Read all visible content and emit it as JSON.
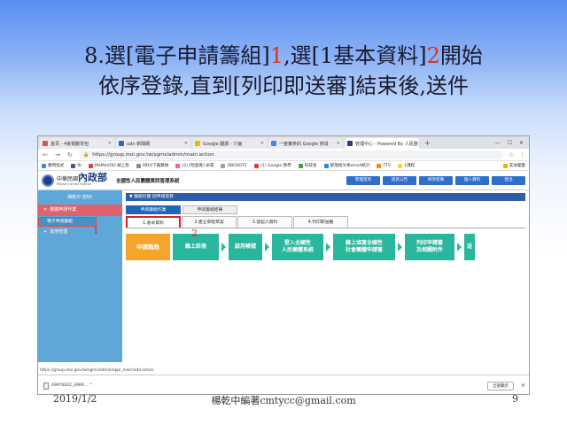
{
  "slide": {
    "title_line1_pre": "8.選[電子申請籌組]",
    "marker1": "1",
    "title_line1_mid": ",選[1基本資料]",
    "marker2": "2",
    "title_line1_post": "開始",
    "title_line2": "依序登錄,直到[列印即送審]結束後,送件",
    "footer_date": "2019/1/2",
    "footer_author": "楊乾中編著cmtycc@gmail.com",
    "footer_page": "9"
  },
  "browser": {
    "tabs": [
      {
        "label": "首頁 - 4後電動背包",
        "fav_color": "#d9534f",
        "active": false
      },
      {
        "label": "udn 新聞網",
        "fav_color": "#2b6cb0",
        "active": false
      },
      {
        "label": "Google 翻譯 - 介面",
        "fav_color": "#f4b400",
        "active": false
      },
      {
        "label": "一度實參的 Google 搜尋",
        "fav_color": "#4285f4",
        "active": false
      },
      {
        "label": "管理中心 - Powered By 人民團",
        "fav_color": "#1f3f8a",
        "active": true
      }
    ],
    "newtab": "+",
    "url": "https://group.moi.gov.tw/sgms/admin/main.action",
    "bookmarks": [
      "應用程式",
      "fb",
      "MoMoVOD 線上影",
      "MDO下載數據",
      "(2) [暗巫廠] 命運",
      "OBOSOTE",
      "(1) Google 教學",
      "科技星",
      "部落格文章email統計",
      "TTV",
      "1課程"
    ],
    "bookmark_other": "其他書籤",
    "status_url": "https://group.moi.gov.tw/sgms/admin/appl_main!add.action",
    "download_file": "49970022_3969... ^",
    "download_all": "全部顯示"
  },
  "site": {
    "logo_prefix": "中華民國",
    "logo_main": "內政部",
    "logo_sub": "Ministry of the Interior",
    "system_name": "全國性人民團體資訊管理系統",
    "header_buttons": [
      "管理首頁",
      "訊息公告",
      "修改密碼",
      "個人資料",
      "登出"
    ]
  },
  "sidebar": {
    "user_greeting": "陳乾中 您好!",
    "items": [
      {
        "label": "團體申請作業",
        "open": true
      },
      {
        "label": "其他管理",
        "open": false
      }
    ],
    "sub_item": "電子申請籌組",
    "marker": "1"
  },
  "main": {
    "breadcrumb": "▼ 籌組社團 回申請首頁",
    "subtabs": [
      "申請籌組作業",
      "申請籌組結果"
    ],
    "steps": [
      "1.基本資料",
      "2.建立章程草案",
      "3.發起人資料",
      "4.列印即送審"
    ],
    "step_marker": "2",
    "flow_head": "申請階段",
    "flow": [
      "線上註冊",
      "啟用帳號",
      "登入全國性\n人民團體系統",
      "線上填寫全國性\n社會團體申請書",
      "列印申請書\n及相關附件",
      "送"
    ]
  },
  "colors": {
    "accent": "#1e66b9",
    "flow_green": "#2ab69d",
    "flow_orange": "#f4a52a",
    "sidebar": "#5fa7d9",
    "marker_red": "#e0301e"
  }
}
